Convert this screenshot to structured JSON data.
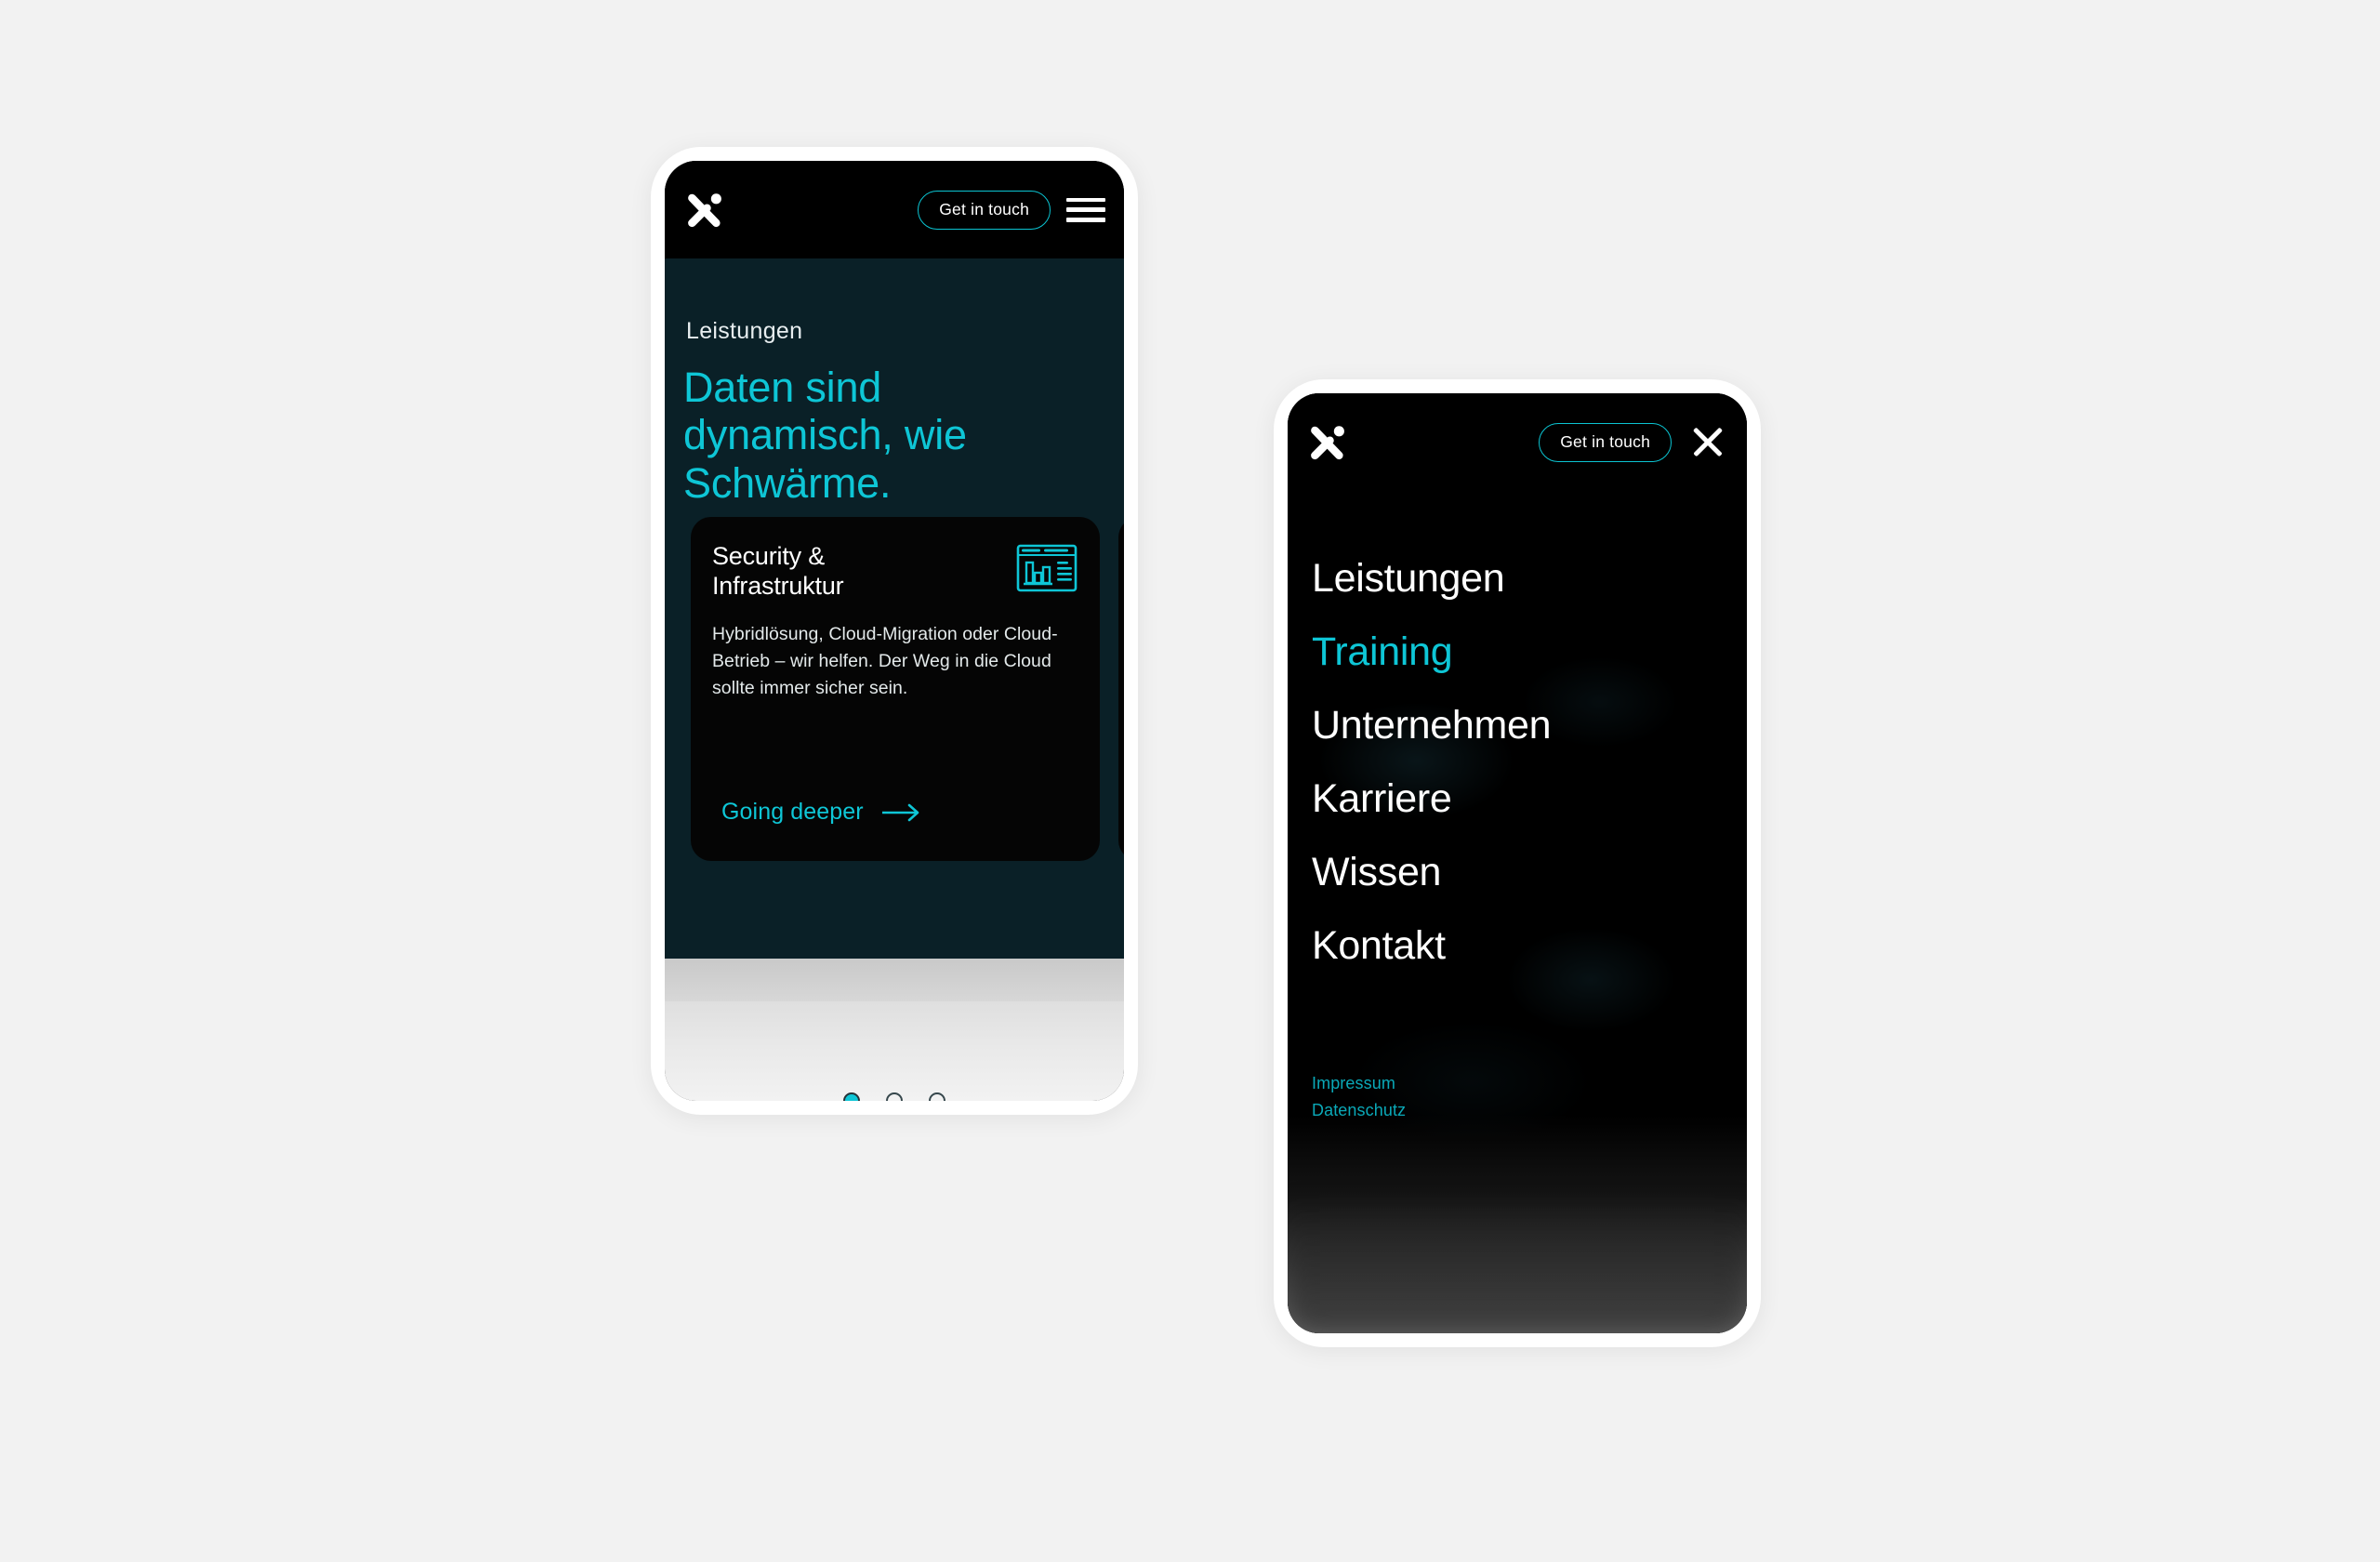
{
  "theme": {
    "accent": "#0ec6d6",
    "accent_dim": "#0aa9b8",
    "hero_bg": "#0a2027",
    "card_bg": "#050505",
    "page_bg": "#f2f2f2",
    "text_light": "#ffffff"
  },
  "brand": {
    "logo_name": "x-swarm-logo"
  },
  "left_phone": {
    "topbar": {
      "cta_label": "Get in touch",
      "menu_icon": "hamburger-icon"
    },
    "hero": {
      "eyebrow": "Leistungen",
      "headline": "Daten sind dynamisch, wie Schwärme."
    },
    "carousel": {
      "cards": [
        {
          "title": "Security & Infrastruktur",
          "icon": "dashboard-chart-icon",
          "body": "Hybridlösung, Cloud-Migration oder Cloud-Betrieb – wir helfen. Der Weg in die Cloud sollte immer sicher sein.",
          "cta_label": "Going deeper",
          "cta_icon": "arrow-right-icon"
        }
      ],
      "dots": {
        "count": 3,
        "active_index": 0
      }
    }
  },
  "right_phone": {
    "topbar": {
      "cta_label": "Get in touch",
      "close_icon": "close-icon"
    },
    "menu": {
      "items": [
        {
          "label": "Leistungen",
          "active": false
        },
        {
          "label": "Training",
          "active": true
        },
        {
          "label": "Unternehmen",
          "active": false
        },
        {
          "label": "Karriere",
          "active": false
        },
        {
          "label": "Wissen",
          "active": false
        },
        {
          "label": "Kontakt",
          "active": false
        }
      ],
      "footer_links": [
        {
          "label": "Impressum"
        },
        {
          "label": "Datenschutz"
        }
      ]
    }
  }
}
